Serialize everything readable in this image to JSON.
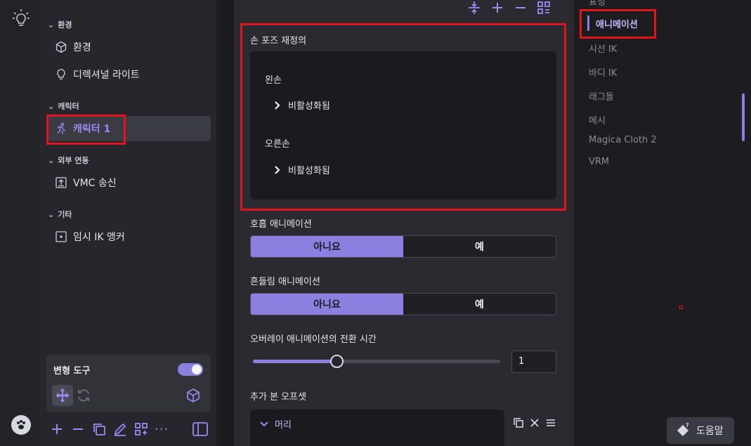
{
  "hierarchy": {
    "sections": {
      "environment": "환경",
      "character": "캐릭터",
      "external": "외부 연동",
      "other": "기타"
    },
    "items": {
      "environment": "환경",
      "light": "디렉셔널 라이트",
      "character": "캐릭터 1",
      "vmc": "VMC 송신",
      "ik_anchor": "임시 IK 앵커"
    },
    "transform_tool": "변형 도구"
  },
  "inspector": {
    "hand_pose_title": "손 포즈 재정의",
    "left_hand": "왼손",
    "right_hand": "오른손",
    "disabled": "비활성화됨",
    "breathing_label": "호흡 애니메이션",
    "sway_label": "흔들림 애니메이션",
    "no": "아니요",
    "yes": "예",
    "overlay_label": "오버레이 애니메이션의 전환 시간",
    "overlay_value": "1",
    "overlay_slider_fraction": 0.34,
    "extra_bone_label": "추가 본 오프셋",
    "head": "머리"
  },
  "nav": {
    "partial_top": "표정",
    "items": [
      "애니메이션",
      "시선 IK",
      "바디 IK",
      "래그돌",
      "메시",
      "Magica Cloth 2",
      "VRM"
    ],
    "active": "애니메이션"
  },
  "help_label": "도움말",
  "colors": {
    "accent": "#8b80e0",
    "highlight": "#e0141b"
  },
  "icons": [
    "lightbulb-icon",
    "cube-icon",
    "bulb-icon",
    "runner-icon",
    "upload-icon",
    "anchor-icon",
    "move-icon",
    "refresh-icon",
    "box-icon",
    "plus-icon",
    "minus-icon",
    "copy-icon",
    "edit-icon",
    "grid-icon",
    "more-icon",
    "panel-icon",
    "collapse-icon",
    "close-icon",
    "menu-icon",
    "help-icon",
    "paw-icon"
  ]
}
